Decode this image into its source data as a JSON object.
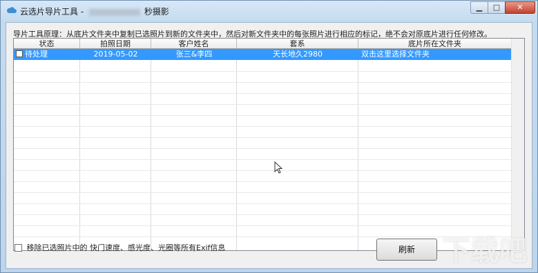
{
  "window": {
    "title": "云选片导片工具 -",
    "title_suffix": "秒摄影"
  },
  "description": "导片工具原理：从底片文件夹中复制已选照片到新的文件夹中，然后对新文件夹中的每张照片进行相应的标记，绝不会对原底片进行任何修改。",
  "table": {
    "columns": [
      "状态",
      "拍照日期",
      "客户姓名",
      "套系",
      "底片所在文件夹"
    ],
    "rows": [
      {
        "status": "待处理",
        "date": "2019-05-02",
        "customer": "张三&李四",
        "package": "天长地久2980",
        "folder": "双击这里选择文件夹",
        "checked": false,
        "selected": true
      }
    ]
  },
  "options": {
    "remove_exif_label": "移除已选照片中的 快门速度、感光度、光圈等所有Exif信息",
    "remove_exif_checked": false
  },
  "buttons": {
    "refresh": "刷新"
  },
  "watermark": "下载吧",
  "colors": {
    "selection": "#3399ff",
    "title_bar": "#c9dff1"
  }
}
